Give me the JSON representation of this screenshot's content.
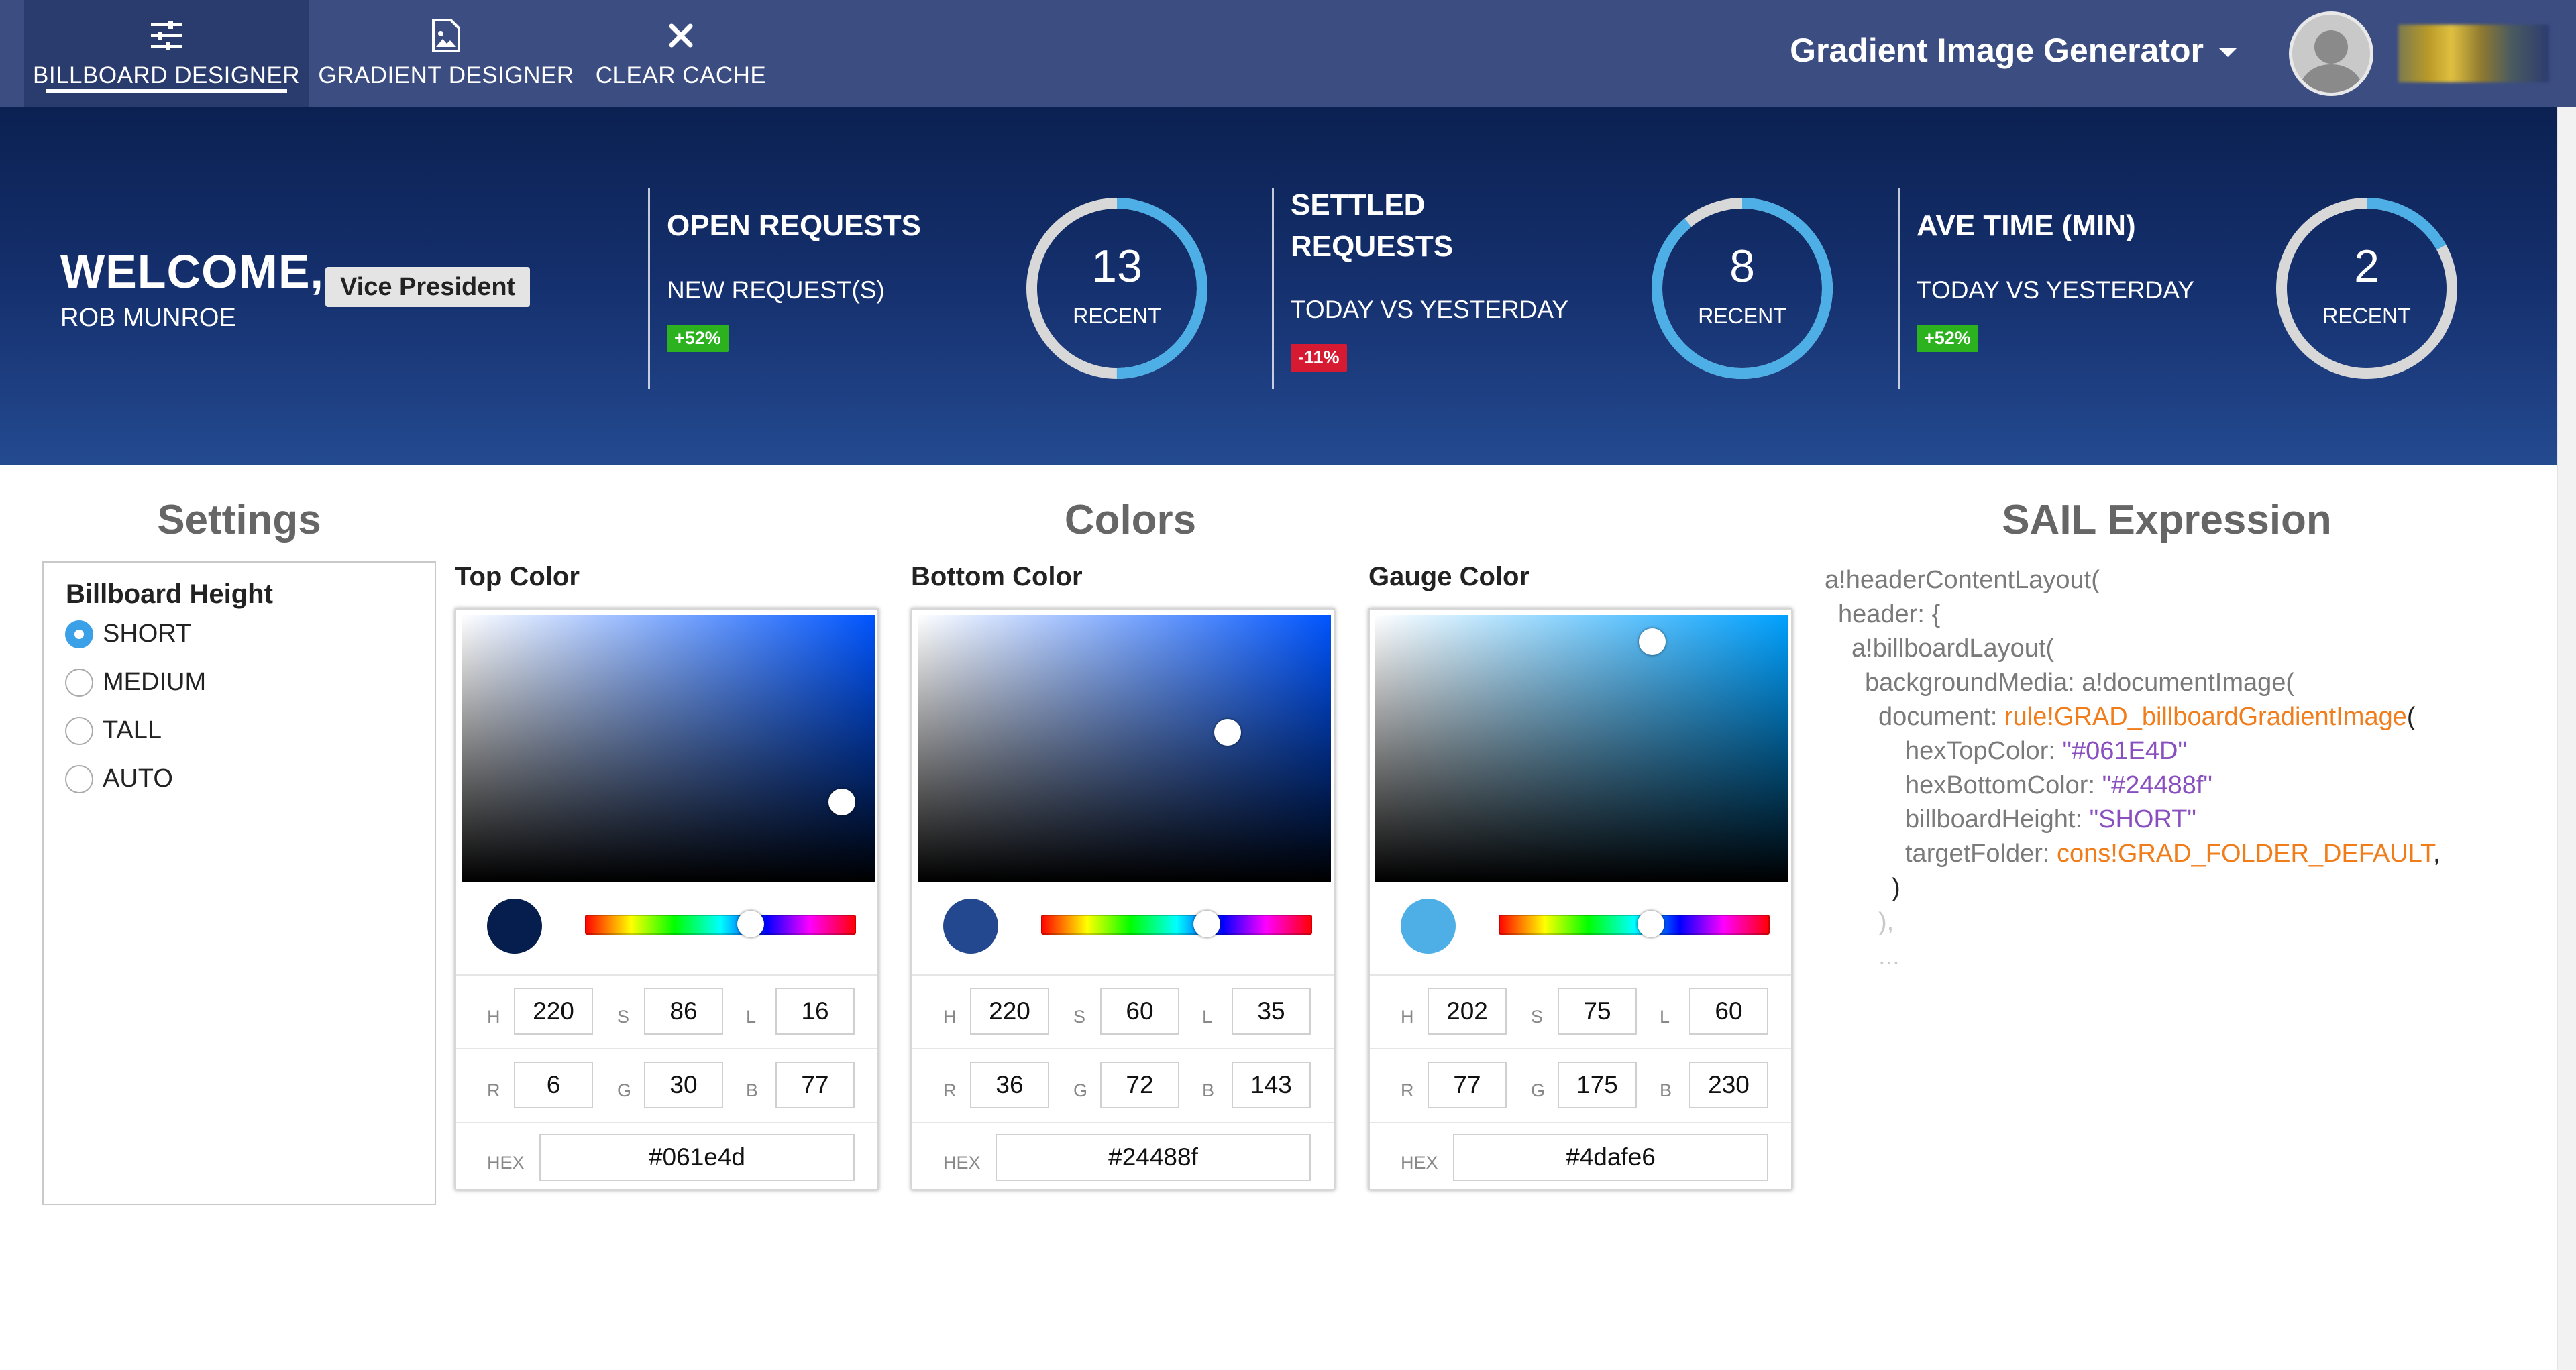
{
  "nav": {
    "tabs": [
      {
        "label": "BILLBOARD DESIGNER",
        "icon": "sliders-icon",
        "active": true
      },
      {
        "label": "GRADIENT DESIGNER",
        "icon": "image-icon",
        "active": false
      },
      {
        "label": "CLEAR CACHE",
        "icon": "close-icon",
        "active": false
      }
    ],
    "app_title": "Gradient Image Generator"
  },
  "billboard": {
    "welcome": "WELCOME,",
    "user_name": "ROB MUNROE",
    "role": "Vice President",
    "kpis": [
      {
        "title": "OPEN REQUESTS",
        "subtitle": "NEW REQUEST(S)",
        "badge": "+52%",
        "badge_type": "up",
        "value": "13",
        "value_label": "RECENT",
        "gauge_fraction": 0.5
      },
      {
        "title": "SETTLED REQUESTS",
        "title_line1": "SETTLED",
        "title_line2": "REQUESTS",
        "subtitle": "TODAY VS YESTERDAY",
        "badge": "-11%",
        "badge_type": "down",
        "value": "8",
        "value_label": "RECENT",
        "gauge_fraction": 0.89
      },
      {
        "title": "AVE TIME (MIN)",
        "subtitle": "TODAY VS YESTERDAY",
        "badge": "+52%",
        "badge_type": "up",
        "value": "2",
        "value_label": "RECENT",
        "gauge_fraction": 0.17
      }
    ],
    "gauge_color": "#4dafe6",
    "gauge_track_color": "#d8d8d8"
  },
  "settings": {
    "title": "Settings",
    "field_label": "Billboard Height",
    "options": [
      "SHORT",
      "MEDIUM",
      "TALL",
      "AUTO"
    ],
    "selected": "SHORT"
  },
  "colors": {
    "title": "Colors",
    "pickers": [
      {
        "label": "Top Color",
        "h": "220",
        "s": "86",
        "l": "16",
        "r": "6",
        "g": "30",
        "b": "77",
        "hex": "#061e4d",
        "swatch": "#061e4d",
        "hue_deg": 220,
        "sat": 0.92,
        "val": 0.3
      },
      {
        "label": "Bottom Color",
        "h": "220",
        "s": "60",
        "l": "35",
        "r": "36",
        "g": "72",
        "b": "143",
        "hex": "#24488f",
        "swatch": "#24488f",
        "hue_deg": 220,
        "sat": 0.75,
        "val": 0.56
      },
      {
        "label": "Gauge Color",
        "h": "202",
        "s": "75",
        "l": "60",
        "r": "77",
        "g": "175",
        "b": "230",
        "hex": "#4dafe6",
        "swatch": "#4dafe6",
        "hue_deg": 202,
        "sat": 0.67,
        "val": 0.9
      }
    ],
    "field_labels": {
      "h": "H",
      "s": "S",
      "l": "L",
      "r": "R",
      "g": "G",
      "b": "B",
      "hex": "HEX"
    }
  },
  "sail": {
    "title": "SAIL Expression",
    "lines": [
      {
        "indent": 0,
        "parts": [
          {
            "t": "a!headerContentLayout(",
            "c": "k"
          }
        ]
      },
      {
        "indent": 1,
        "parts": [
          {
            "t": "header: {",
            "c": "k"
          }
        ]
      },
      {
        "indent": 2,
        "parts": [
          {
            "t": "a!billboardLayout(",
            "c": "k"
          }
        ]
      },
      {
        "indent": 3,
        "parts": [
          {
            "t": "backgroundMedia: a!documentImage(",
            "c": "k"
          }
        ]
      },
      {
        "indent": 4,
        "parts": [
          {
            "t": "document: ",
            "c": "k"
          },
          {
            "t": "rule!GRAD_billboardGradientImage",
            "c": "o"
          },
          {
            "t": "(",
            "c": "d"
          }
        ]
      },
      {
        "indent": 6,
        "parts": [
          {
            "t": "hexTopColor: ",
            "c": "k"
          },
          {
            "t": "\"#061E4D\"",
            "c": "p"
          }
        ]
      },
      {
        "indent": 6,
        "parts": [
          {
            "t": "hexBottomColor: ",
            "c": "k"
          },
          {
            "t": "\"#24488f\"",
            "c": "p"
          }
        ]
      },
      {
        "indent": 6,
        "parts": [
          {
            "t": "billboardHeight: ",
            "c": "k"
          },
          {
            "t": "\"SHORT\"",
            "c": "p"
          }
        ]
      },
      {
        "indent": 6,
        "parts": [
          {
            "t": "targetFolder: ",
            "c": "k"
          },
          {
            "t": "cons!GRAD_FOLDER_DEFAULT",
            "c": "o"
          },
          {
            "t": ",",
            "c": "d"
          }
        ]
      },
      {
        "indent": 5,
        "parts": [
          {
            "t": ")",
            "c": "d"
          }
        ]
      },
      {
        "indent": 4,
        "parts": [
          {
            "t": "),",
            "c": "x"
          }
        ]
      },
      {
        "indent": 4,
        "parts": [
          {
            "t": "...",
            "c": "x"
          }
        ]
      }
    ]
  }
}
